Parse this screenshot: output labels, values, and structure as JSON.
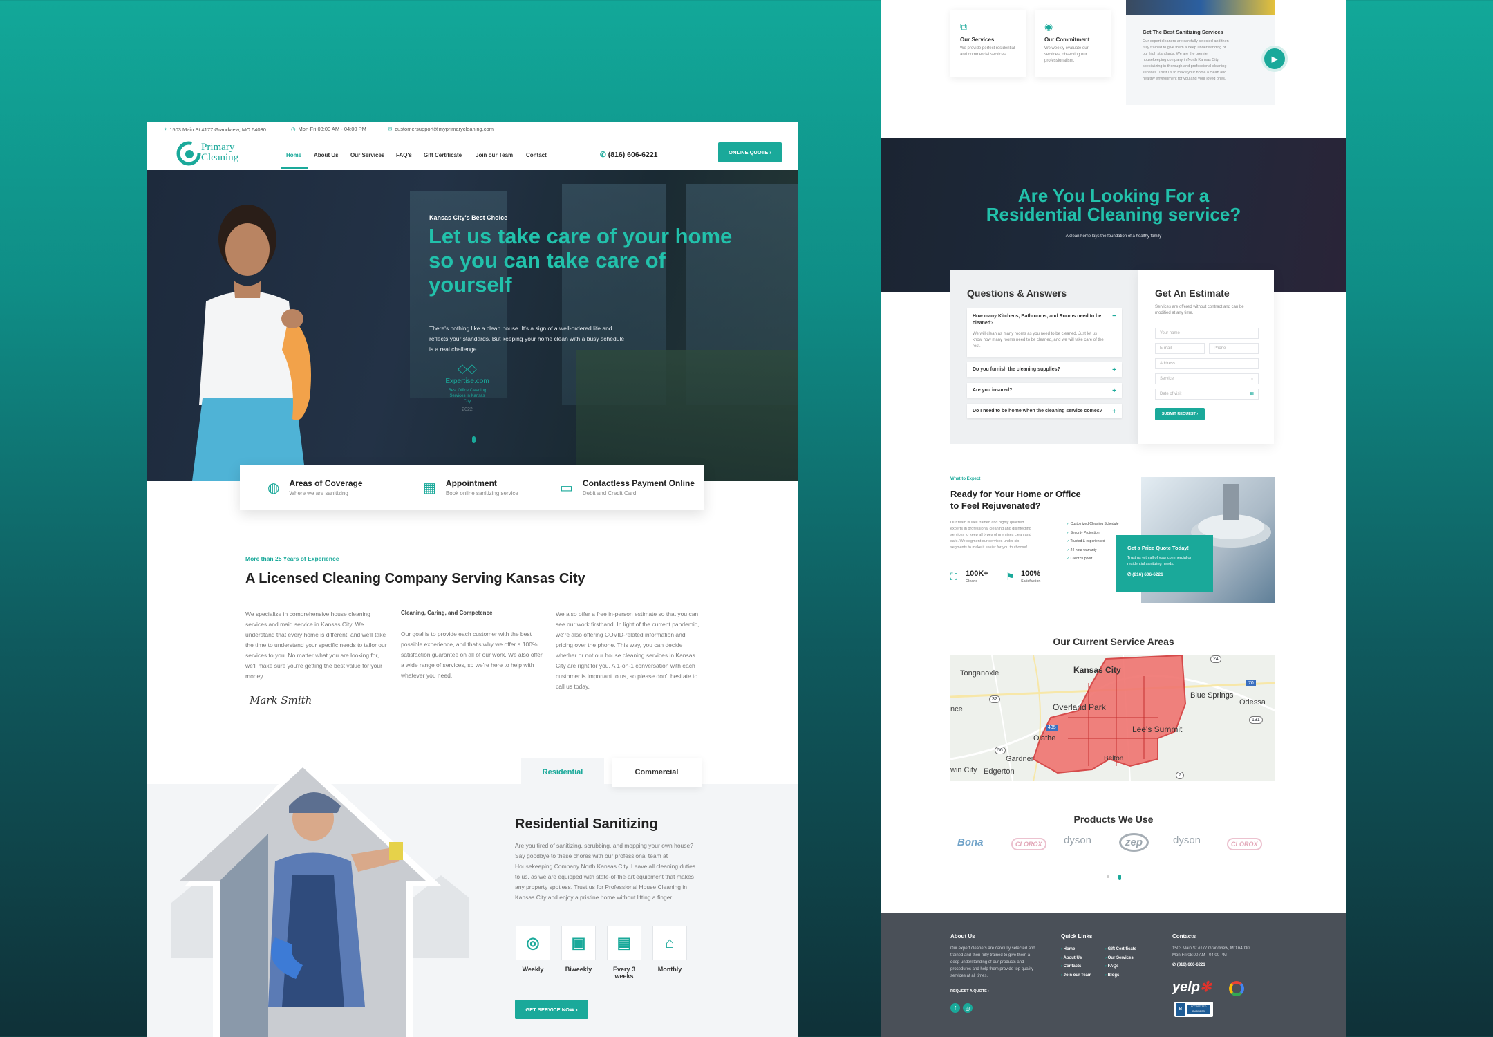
{
  "brand": {
    "logo_line1": "Primary",
    "logo_line2": "Cleaning"
  },
  "topbar": {
    "address": "1503 Main St #177 Grandview, MO 64030",
    "hours": "Mon-Fri 08:00 AM - 04:00 PM",
    "email": "customersupport@myprimarycleaning.com"
  },
  "nav": {
    "items": [
      "Home",
      "About Us",
      "Our Services",
      "FAQ's",
      "Gift Certificate",
      "Join our Team",
      "Contact"
    ],
    "phone": "(816) 606-6221",
    "cta": "ONLINE QUOTE"
  },
  "hero": {
    "eyebrow": "Kansas City's Best Choice",
    "title": "Let us take care of your home so you can take care of yourself",
    "text": "There's nothing like a clean house. It's a sign of a well-ordered life and reflects your standards. But keeping your home clean with a busy schedule is a real challenge.",
    "badge_site": "Expertise.com",
    "badge_text": "Best Office Cleaning Services in Kansas City",
    "badge_year": "2022"
  },
  "features": [
    {
      "title": "Areas of Coverage",
      "sub": "Where we are sanitizing",
      "icon": "globe-icon"
    },
    {
      "title": "Appointment",
      "sub": "Book online sanitizing service",
      "icon": "calendar-icon"
    },
    {
      "title": "Contactless Payment Online",
      "sub": "Debit and Credit Card",
      "icon": "card-icon"
    }
  ],
  "about": {
    "eyebrow": "More than 25 Years of Experience",
    "title": "A Licensed Cleaning Company Serving Kansas City",
    "col1": "We specialize in comprehensive house cleaning services and maid service in Kansas City. We understand that every home is different, and we'll take the time to understand your specific needs to tailor our services to you. No matter what you are looking for, we'll make sure you're getting the best value for your money.",
    "col2_title": "Cleaning, Caring, and Competence",
    "col2": "Our goal is to provide each customer with the best possible experience, and that's why we offer a 100% satisfaction guarantee on all of our work. We also offer a wide range of services, so we're here to help with whatever you need.",
    "col3": "We also offer a free in-person estimate so that you can see our work firsthand. In light of the current pandemic, we're also offering COVID-related information and pricing over the phone. This way, you can decide whether or not our house cleaning services in Kansas City are right for you. A 1-on-1 conversation with each customer is important to us, so please don't hesitate to call us today.",
    "signature": "Mark Smith"
  },
  "services": {
    "tabs": [
      "Residential",
      "Commercial"
    ],
    "title": "Residential Sanitizing",
    "text": "Are you tired of sanitizing, scrubbing, and mopping your own house? Say goodbye to these chores with our professional team at Housekeeping Company North Kansas City. Leave all cleaning duties to us, as we are equipped with state-of-the-art equipment that makes any property spotless. Trust us for Professional House Cleaning in Kansas City and enjoy a pristine home without lifting a finger.",
    "freqs": [
      "Weekly",
      "Biweekly",
      "Every 3 weeks",
      "Monthly"
    ],
    "cta": "GET SERVICE NOW"
  },
  "right_top": {
    "card1_title": "Our Services",
    "card1_text": "We provide perfect residential and commercial services.",
    "card2_title": "Our Commitment",
    "card2_text": "We weekly evaluate our services, observing our professionalism.",
    "video_title": "Get The Best Sanitizing Services",
    "video_text": "Our expert cleaners are carefully selected and then fully trained to give them a deep understanding of our high standards. We are the premier housekeeping company in North Kansas City, specializing in thorough and professional cleaning services. Trust us to make your home a clean and healthy environment for you and your loved ones."
  },
  "residential": {
    "title_line1": "Are You Looking For a",
    "title_line2": "Residential Cleaning service?",
    "sub": "A clean home lays the foundation of a healthy family"
  },
  "qa": {
    "title": "Questions & Answers",
    "q1": "How many Kitchens, Bathrooms, and Rooms need to be cleaned?",
    "a1": "We will clean as many rooms as you need to be cleaned. Just let us know how many rooms need to be cleaned, and we will take care of the rest.",
    "q2": "Do you furnish the cleaning supplies?",
    "q3": "Are you insured?",
    "q4": "Do I need to be home when the cleaning service comes?"
  },
  "estimate": {
    "title": "Get An Estimate",
    "text": "Services are offered without contract and can be modified at any time.",
    "name": "Your name",
    "email": "E-mail",
    "phone": "Phone",
    "address": "Address",
    "service": "Service",
    "date": "Date of visit",
    "submit": "SUBMIT REQUEST"
  },
  "expect": {
    "eyebrow": "What to Expect",
    "title": "Ready for Your Home or Office to Feel Rejuvenated?",
    "text": "Our team is well trained and highly qualified experts in professional cleaning and disinfecting services to keep all types of premises clean and safe. We segment our services under six segments to make it easier for you to choose!",
    "checks": [
      "Customized Cleaning Schedule",
      "Security Protection",
      "Trusted & experienced",
      "24-hour warranty",
      "Client Support"
    ],
    "stat1_num": "100K+",
    "stat1_label": "Cleans",
    "stat2_num": "100%",
    "stat2_label": "Satisfaction",
    "quote_title": "Get a Price Quote Today!",
    "quote_text": "Trust us with all of your commercial or residential sanitizing needs.",
    "quote_phone": "(816) 606-6221"
  },
  "areas": {
    "title": "Our Current Service Areas",
    "labels": [
      "Tonganoxie",
      "Kansas City",
      "Overland Park",
      "Blue Springs",
      "Odessa",
      "Olathe",
      "Lee's Summit",
      "Gardner",
      "Belton",
      "Edgerton",
      "nce",
      "win City"
    ],
    "routes": [
      "24",
      "70",
      "32",
      "435",
      "131",
      "7",
      "56"
    ]
  },
  "products": {
    "title": "Products We Use",
    "brands": [
      "Bona",
      "CLOROX",
      "dyson",
      "zep",
      "dyson",
      "CLOROX"
    ]
  },
  "footer": {
    "about_title": "About Us",
    "about_text": "Our expert cleaners are carefully selected and trained and then fully trained to give them a deep understanding of our products and procedures and help them provide top quality services at all times.",
    "request": "REQUEST A QUOTE",
    "links_title": "Quick Links",
    "links1": [
      "Home",
      "About Us",
      "Contacts",
      "Join our Team"
    ],
    "links2": [
      "Gift Certificate",
      "Our Services",
      "FAQs",
      "Blogs"
    ],
    "contacts_title": "Contacts",
    "contact_address": "1503 Main St #177 Grandview, MO 64030",
    "contact_hours": "Mon-Fri 08:00 AM - 04:00 PM",
    "contact_phone": "(816) 606-6221",
    "yelp": "yelp",
    "bbb": "ACCREDITED BUSINESS"
  },
  "colors": {
    "accent": "#1aa99a",
    "dark": "#1e2a3b",
    "footer": "#4a5058"
  }
}
